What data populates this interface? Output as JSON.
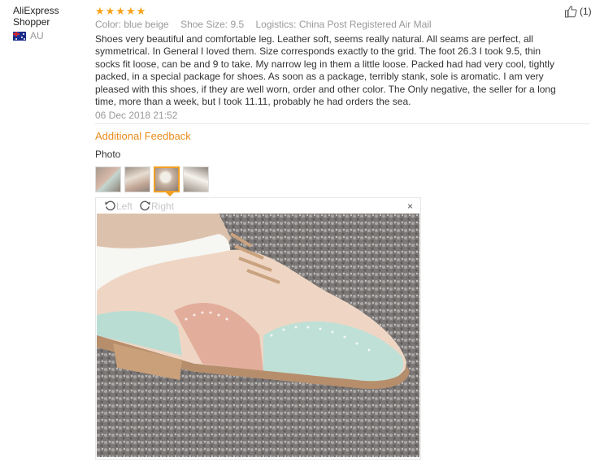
{
  "reviewer": {
    "name": "AliExpress Shopper",
    "country": "AU"
  },
  "rating": {
    "stars": 5,
    "max": 5,
    "star_icon": "star-icon",
    "color": "#f8a31b"
  },
  "attributes": {
    "color": "Color: blue beige",
    "shoe_size": "Shoe Size: 9.5",
    "logistics": "Logistics: China Post Registered Air Mail"
  },
  "review_text": "Shoes very beautiful and comfortable leg. Leather soft, seems really natural. All seams are perfect, all symmetrical. In General I loved them. Size corresponds exactly to the grid. The foot 26.3 I took 9.5, thin socks fit loose, can be and 9 to take. My narrow leg in them a little loose. Packed had had very cool, tightly packed, in a special package for shoes. As soon as a package, terribly stank, sole is aromatic. I am very pleased with this shoes, if they are well worn, order and other color. The Only negative, the seller for a long time, more than a week, but I took 11.11, probably he had orders the sea.",
  "date": "06 Dec 2018 21:52",
  "like": {
    "icon": "thumbs-up-icon",
    "count": "(1)"
  },
  "additional_feedback": {
    "title": "Additional Feedback",
    "photo_label": "Photo"
  },
  "thumbnails": {
    "count": 4,
    "selected_index": 2
  },
  "viewer": {
    "rotate_left": "Left",
    "rotate_right": "Right",
    "close": "×"
  },
  "colors": {
    "accent": "#e98c1d",
    "muted": "#999999",
    "thumbnail_active": "#f0a020"
  }
}
